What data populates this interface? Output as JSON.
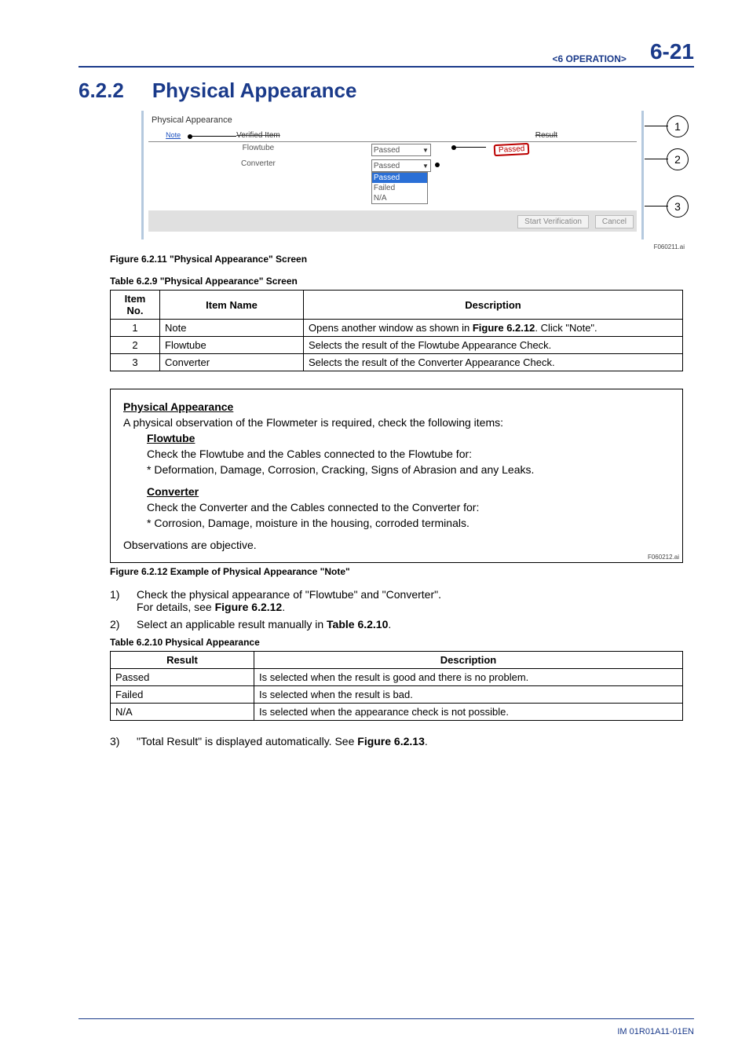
{
  "header": {
    "section_path": "<6  OPERATION>",
    "page_number": "6-21"
  },
  "heading": {
    "number": "6.2.2",
    "title": "Physical Appearance"
  },
  "screenshot": {
    "panel_title": "Physical Appearance",
    "col_item": "Verified Item",
    "col_result": "Result",
    "note_link": "Note",
    "row_flowtube": "Flowtube",
    "row_converter": "Converter",
    "combo_value": "Passed",
    "dropdown_opts": {
      "a": "Passed",
      "b": "Failed",
      "c": "N/A"
    },
    "badge": "Passed",
    "btn_start": "Start Verification",
    "btn_cancel": "Cancel",
    "callouts": {
      "c1": "1",
      "c2": "2",
      "c3": "3"
    },
    "file_tag": "F060211.ai"
  },
  "fig_caption_1": "Figure 6.2.11 \"Physical Appearance\" Screen",
  "table1": {
    "caption": "Table 6.2.9 \"Physical Appearance\" Screen",
    "h_no": "Item No.",
    "h_name": "Item Name",
    "h_desc": "Description",
    "rows": [
      {
        "no": "1",
        "name": "Note",
        "desc_a": "Opens another window as shown in ",
        "desc_b": "Figure 6.2.12",
        "desc_c": ". Click \"Note\"."
      },
      {
        "no": "2",
        "name": "Flowtube",
        "desc": "Selects the result of the Flowtube Appearance Check."
      },
      {
        "no": "3",
        "name": "Converter",
        "desc": "Selects the result of the Converter Appearance Check."
      }
    ]
  },
  "note": {
    "title": "Physical Appearance",
    "intro": "A physical observation of the Flowmeter is required, check the following items:",
    "flow_h": "Flowtube",
    "flow_1": "Check the Flowtube and the Cables connected to the Flowtube for:",
    "flow_2": " * Deformation, Damage, Corrosion, Cracking, Signs of Abrasion and any Leaks.",
    "conv_h": "Converter",
    "conv_1": "Check the Converter and the Cables connected to the Converter for:",
    "conv_2": " * Corrosion, Damage, moisture in the housing, corroded terminals.",
    "obs": "Observations are objective.",
    "file_tag": "F060212.ai"
  },
  "fig_caption_2": "Figure 6.2.12 Example of Physical Appearance \"Note\"",
  "steps": {
    "s1a": "Check the physical appearance of \"Flowtube\" and \"Converter\".",
    "s1b_a": "For details, see ",
    "s1b_b": "Figure 6.2.12",
    "s1b_c": ".",
    "s2_a": "Select an applicable result manually in ",
    "s2_b": "Table 6.2.10",
    "s2_c": ".",
    "s3_a": "\"Total Result\" is displayed automatically. See ",
    "s3_b": "Figure 6.2.13",
    "s3_c": "."
  },
  "table2": {
    "caption": "Table 6.2.10 Physical Appearance",
    "h_res": "Result",
    "h_desc": "Description",
    "rows": [
      {
        "r": "Passed",
        "d": "Is selected when the result is good and there is no problem."
      },
      {
        "r": "Failed",
        "d": "Is selected when the result is bad."
      },
      {
        "r": "N/A",
        "d": "Is selected when the appearance check is not possible."
      }
    ]
  },
  "footer": {
    "doc_id": "IM 01R01A11-01EN"
  }
}
